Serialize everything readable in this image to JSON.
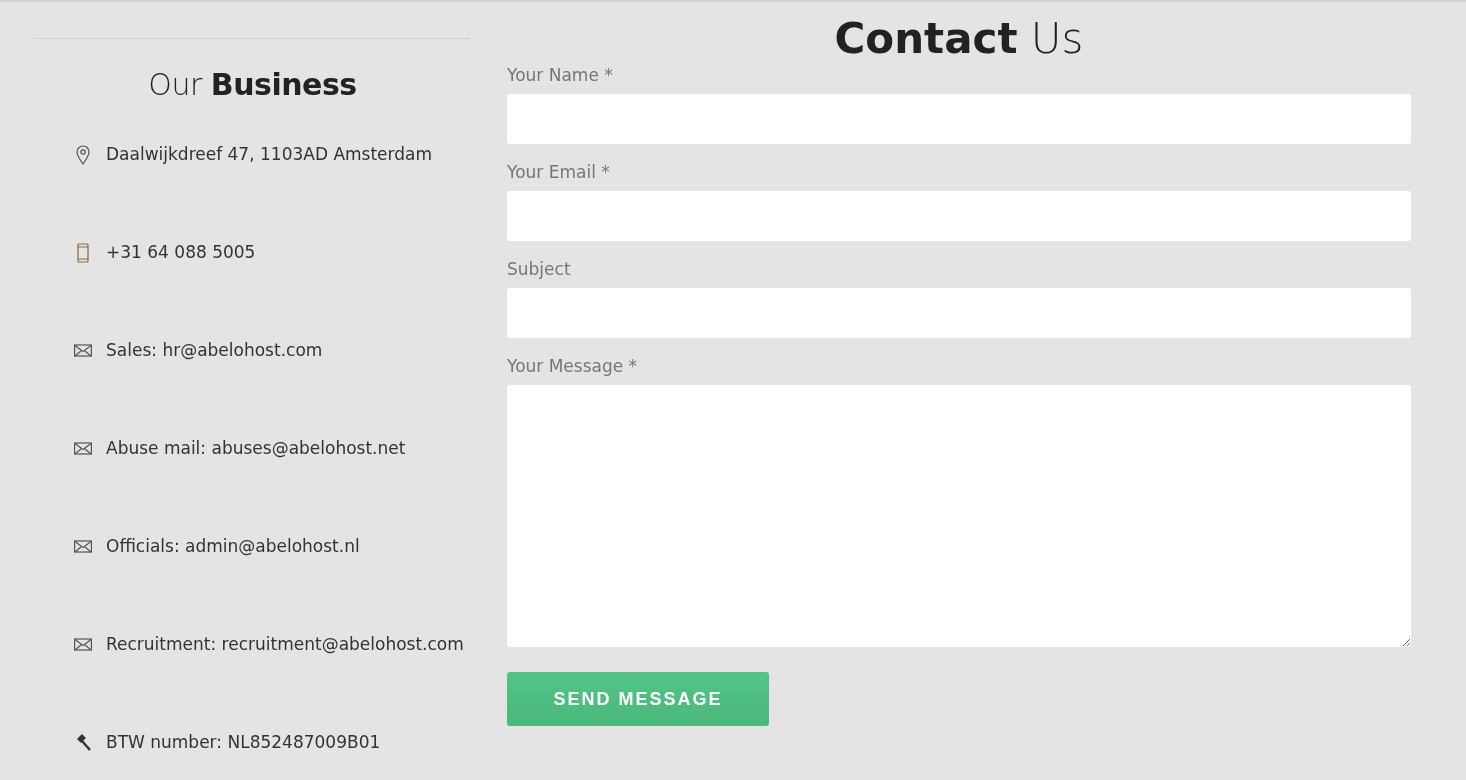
{
  "business": {
    "title": "Our **Business**",
    "items": [
      {
        "kind": "pin",
        "text": "Daalwijkdreef 47, 1103AD Amsterdam"
      },
      {
        "kind": "phone",
        "text": "+31 64 088 5005"
      },
      {
        "kind": "mail",
        "text": "Sales: hr@abelohost.com"
      },
      {
        "kind": "mail",
        "text": "Abuse mail: abuses@abelohost.net"
      },
      {
        "kind": "mail",
        "text": "Officials: admin@abelohost.nl"
      },
      {
        "kind": "mail",
        "text": "Recruitment: recruitment@abelohost.com"
      },
      {
        "kind": "gavel",
        "text": "BTW number: NL852487009B01"
      }
    ]
  },
  "contact": {
    "title": "**Contact** Us",
    "fields": [
      {
        "kind": "input",
        "label": "Your Name *"
      },
      {
        "kind": "input",
        "label": "Your Email *"
      },
      {
        "kind": "input",
        "label": "Subject"
      },
      {
        "kind": "textarea",
        "label": "Your Message *"
      }
    ],
    "submit": "SEND MESSAGE"
  }
}
